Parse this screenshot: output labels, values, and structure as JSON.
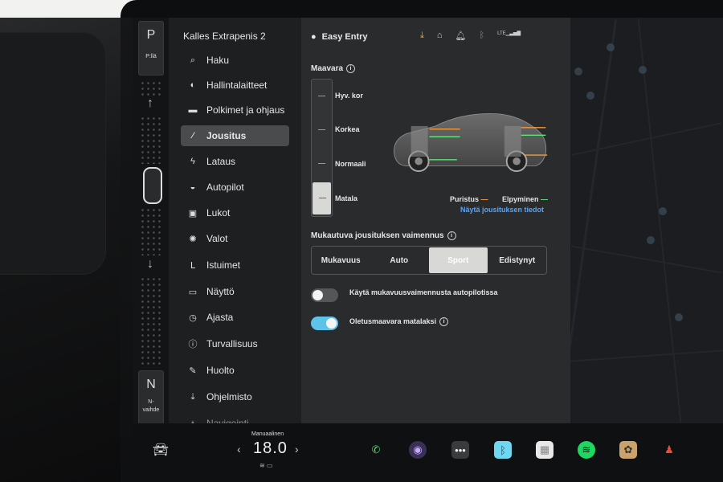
{
  "gear": {
    "current": "P",
    "current_label": "P:llä",
    "neutral": "N",
    "neutral_label_1": "N-",
    "neutral_label_2": "vaihde"
  },
  "sidebar": {
    "car_name": "Kalles Extrapenis 2",
    "items": [
      {
        "label": "Haku",
        "icon": "search-icon",
        "glyph": "⌕"
      },
      {
        "label": "Hallintalaitteet",
        "icon": "toggle-icon",
        "glyph": "◐"
      },
      {
        "label": "Polkimet ja ohjaus",
        "icon": "car-icon",
        "glyph": "▬"
      },
      {
        "label": "Jousitus",
        "icon": "suspension-icon",
        "glyph": "⁄"
      },
      {
        "label": "Lataus",
        "icon": "lightning-icon",
        "glyph": "ϟ"
      },
      {
        "label": "Autopilot",
        "icon": "steering-icon",
        "glyph": "◒"
      },
      {
        "label": "Lukot",
        "icon": "lock-icon",
        "glyph": "▣"
      },
      {
        "label": "Valot",
        "icon": "sun-icon",
        "glyph": "✺"
      },
      {
        "label": "Istuimet",
        "icon": "seat-icon",
        "glyph": "ᒪ"
      },
      {
        "label": "Näyttö",
        "icon": "display-icon",
        "glyph": "▭"
      },
      {
        "label": "Ajasta",
        "icon": "clock-icon",
        "glyph": "◷"
      },
      {
        "label": "Turvallisuus",
        "icon": "info-icon",
        "glyph": "ⓘ"
      },
      {
        "label": "Huolto",
        "icon": "wrench-icon",
        "glyph": "✎"
      },
      {
        "label": "Ohjelmisto",
        "icon": "download-icon",
        "glyph": "⤓"
      },
      {
        "label": "Navigointi",
        "icon": "navigation-icon",
        "glyph": "▲"
      }
    ]
  },
  "header": {
    "profile": "Easy Entry",
    "lte": "LTE"
  },
  "ride_height": {
    "title": "Maavara",
    "options": [
      "Hyv. kor",
      "Korkea",
      "Normaali",
      "Matala"
    ],
    "selected": "Matala",
    "legend_compress": "Puristus",
    "legend_extend": "Elpyminen",
    "details_link": "Näytä jousituksen tiedot",
    "compress_color": "#f39a3a",
    "extend_color": "#5fe07a"
  },
  "damping": {
    "title": "Mukautuva jousituksen vaimennus",
    "options": [
      "Mukavuus",
      "Auto",
      "Sport",
      "Edistynyt"
    ],
    "selected": "Sport"
  },
  "toggles": [
    {
      "label": "Käytä mukavuusvaimennusta autopilotissa",
      "on": false
    },
    {
      "label": "Oletusmaavara matalaksi",
      "on": true
    }
  ],
  "bottom": {
    "temp_label": "Manuaalinen",
    "temp_value": "18.0",
    "left_arrow": "‹",
    "right_arrow": "›"
  },
  "accent_color": "#4fa6ff"
}
